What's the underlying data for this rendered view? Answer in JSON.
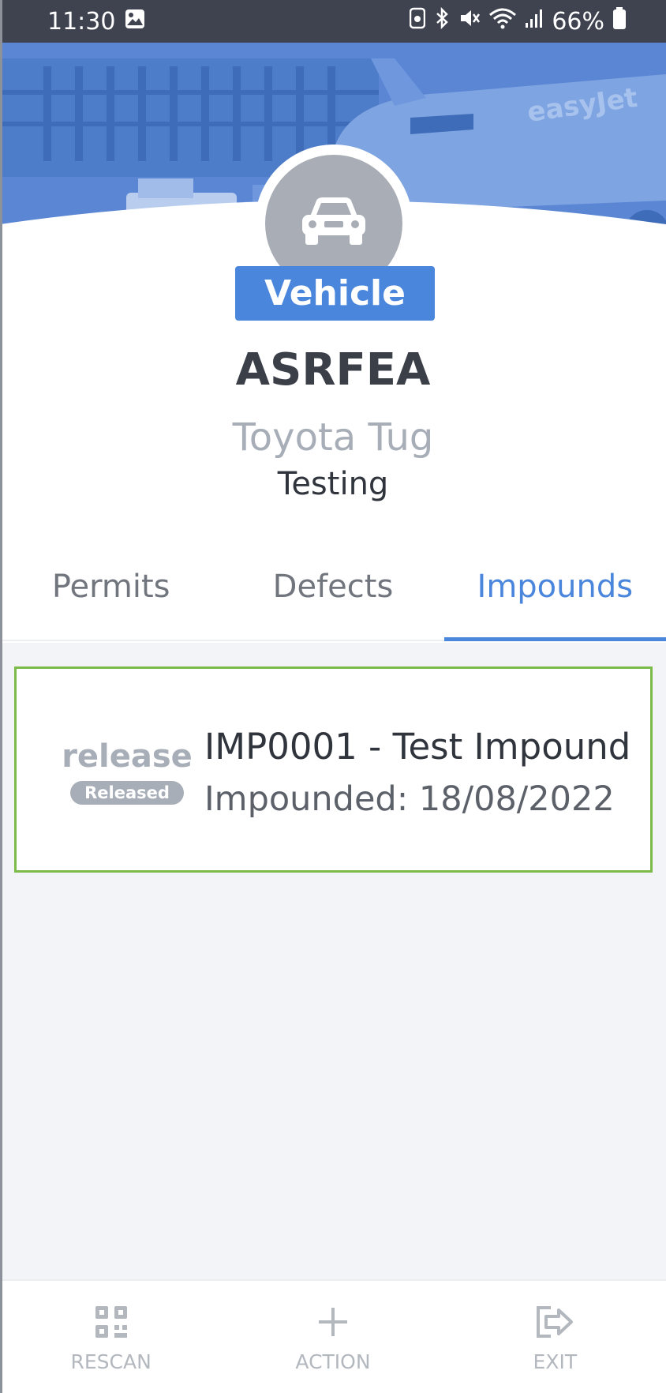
{
  "status_bar": {
    "time": "11:30",
    "battery_percent": "66%",
    "icons": [
      "image-icon",
      "recycle-icon",
      "bluetooth-icon",
      "mute-icon",
      "wifi-icon",
      "signal-icon",
      "battery-icon"
    ]
  },
  "header": {
    "entity_type": "Vehicle",
    "avatar_icon": "car-icon"
  },
  "vehicle": {
    "id": "ASRFEA",
    "model": "Toyota Tug",
    "status": "Testing"
  },
  "tabs": [
    {
      "label": "Permits",
      "active": false
    },
    {
      "label": "Defects",
      "active": false
    },
    {
      "label": "Impounds",
      "active": true
    }
  ],
  "impounds": [
    {
      "action_label": "release",
      "state_badge": "Released",
      "title": "IMP0001 - Test Impound",
      "date_line": "Impounded: 18/08/2022",
      "border_color": "#7cba4a"
    }
  ],
  "bottom_nav": [
    {
      "label": "RESCAN",
      "icon": "qr-code-icon"
    },
    {
      "label": "ACTION",
      "icon": "plus-icon"
    },
    {
      "label": "EXIT",
      "icon": "exit-icon"
    }
  ],
  "colors": {
    "accent": "#4a86dc",
    "status_bar": "#3f4350",
    "success_border": "#7cba4a",
    "muted": "#a8aeb8"
  }
}
